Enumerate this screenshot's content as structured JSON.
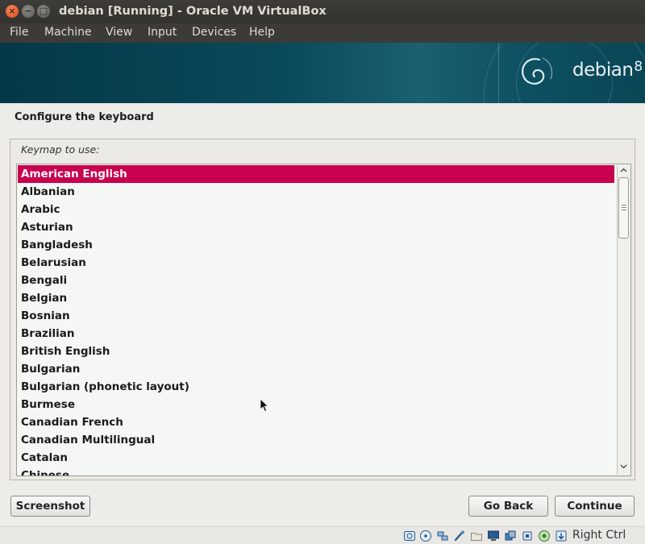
{
  "window": {
    "title": "debian [Running] - Oracle VM VirtualBox",
    "close_glyph": "×",
    "minimize_glyph": "−",
    "maximize_glyph": "□"
  },
  "menubar": {
    "items": [
      "File",
      "Machine",
      "View",
      "Input",
      "Devices",
      "Help"
    ]
  },
  "banner": {
    "brand": "debian",
    "version": "8"
  },
  "page": {
    "heading": "Configure the keyboard",
    "keymap_label": "Keymap to use:"
  },
  "keymaps": {
    "selected": "American English",
    "items": [
      "American English",
      "Albanian",
      "Arabic",
      "Asturian",
      "Bangladesh",
      "Belarusian",
      "Bengali",
      "Belgian",
      "Bosnian",
      "Brazilian",
      "British English",
      "Bulgarian",
      "Bulgarian (phonetic layout)",
      "Burmese",
      "Canadian French",
      "Canadian Multilingual",
      "Catalan",
      "Chinese"
    ]
  },
  "buttons": {
    "screenshot": "Screenshot",
    "go_back": "Go Back",
    "continue": "Continue"
  },
  "statusbar": {
    "host_key": "Right Ctrl",
    "icons": [
      "hard-disk-icon",
      "optical-drive-icon",
      "usb-icon",
      "network-icon",
      "shared-folders-icon",
      "display-icon",
      "video-capture-icon",
      "cpu-icon",
      "mouse-integration-icon",
      "keyboard-capture-icon"
    ]
  },
  "colors": {
    "selection": "#c8004f",
    "banner": "#0a4a5c",
    "titlebar": "#3c3b37"
  }
}
